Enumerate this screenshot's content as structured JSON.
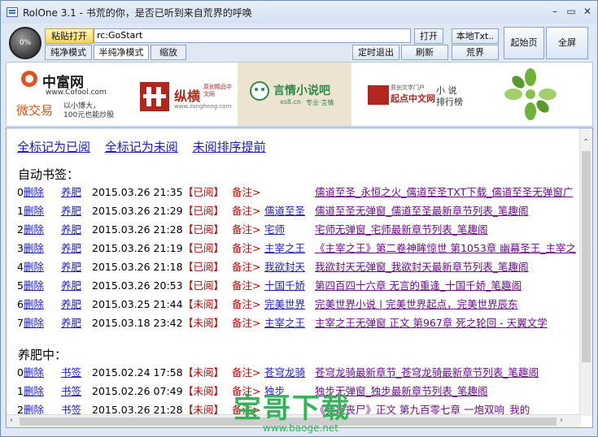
{
  "window": {
    "title": "RolOne 3.1 - 书荒的你，是否已听到来自荒界的呼唤",
    "min": "–",
    "max": "▭",
    "close": "✕"
  },
  "toolbar": {
    "orb_label": "0%",
    "paste_open": "粘贴打开",
    "address_value": "rc:GoStart",
    "open": "打开",
    "local_txt": "本地Txt..",
    "home": "起始页",
    "fullscreen": "全屏",
    "pure_mode": "纯净模式",
    "half_pure_mode": "半纯净模式",
    "zoom": "缩放",
    "timed_exit": "定时退出",
    "refresh": "刷新",
    "wasteland": "荒界"
  },
  "banner": {
    "cofool": {
      "brand": "中富网",
      "url": "www.Cofool.com",
      "slogan1": "微交易",
      "slogan2": "以小博大，",
      "slogan3": "100元也能炒股"
    },
    "zongheng": {
      "brand": "纵横",
      "sub": "原创精品中文网",
      "url": "www.zongheng.com"
    },
    "xs8": {
      "brand": "言情小说吧",
      "url": "xs8.cn",
      "sub": "专业·言情"
    },
    "qidian": {
      "brand": "起点中文网",
      "tag": "原创文学门户",
      "side1": "小 说",
      "side2": "排行榜"
    }
  },
  "links": {
    "mark_all_read": "全标记为已阅",
    "mark_all_unread": "全标记为未阅",
    "unread_first": "未阅排序提前"
  },
  "auto_section": {
    "title": "自动书签：",
    "rows": [
      {
        "idx": "0",
        "del": "删除",
        "op": "养肥",
        "time": "2015.03.26 21:35",
        "status": "【已阅】",
        "note": "备注>",
        "name": "",
        "desc": "儒道至圣_永恒之火_儒道至圣TXT下载_儒道至圣无弹窗广"
      },
      {
        "idx": "1",
        "del": "删除",
        "op": "养肥",
        "time": "2015.03.26 21:29",
        "status": "【已阅】",
        "note": "备注>",
        "name": "儒道至圣",
        "desc": "儒道至圣无弹窗_儒道至圣最新章节列表_笔趣阁"
      },
      {
        "idx": "2",
        "del": "删除",
        "op": "养肥",
        "time": "2015.03.26 21:28",
        "status": "【已阅】",
        "note": "备注>",
        "name": "宅师",
        "desc": "宅师无弹窗_宅师最新章节列表_笔趣阁"
      },
      {
        "idx": "3",
        "del": "删除",
        "op": "养肥",
        "time": "2015.03.26 21:19",
        "status": "【已阅】",
        "note": "备注>",
        "name": "主宰之王",
        "desc": "《主宰之王》第二卷神眸惊世 第1053章 幽幕圣王_主宰之"
      },
      {
        "idx": "4",
        "del": "删除",
        "op": "养肥",
        "time": "2015.03.26 21:18",
        "status": "【已阅】",
        "note": "备注>",
        "name": "我欲封天",
        "desc": "我欲封天无弹窗_我欲封天最新章节列表_笔趣阁"
      },
      {
        "idx": "5",
        "del": "删除",
        "op": "养肥",
        "time": "2015.03.26 20:53",
        "status": "【已阅】",
        "note": "备注>",
        "name": "十国千娇",
        "desc": "第四百四十六章 无言的重逢_十国千娇_笔趣阁"
      },
      {
        "idx": "6",
        "del": "删除",
        "op": "养肥",
        "time": "2015.03.25 21:44",
        "status": "【未阅】",
        "note": "备注>",
        "name": "完美世界",
        "desc": "完美世界小说 | 完美世界起点，完美世界辰东"
      },
      {
        "idx": "7",
        "del": "删除",
        "op": "养肥",
        "time": "2015.03.18 23:42",
        "status": "【未阅】",
        "note": "备注>",
        "name": "主宰之王",
        "desc": "主宰之王无弹窗 正文 第967章 死之轮回 - 天翼文学"
      }
    ]
  },
  "fatten_section": {
    "title": "养肥中：",
    "rows": [
      {
        "idx": "0",
        "del": "删除",
        "op": "书签",
        "time": "2015.02.24 17:58",
        "status": "【未阅】",
        "note": "备注>",
        "name": "苍穹龙骑",
        "desc": "苍穹龙骑最新章节_苍穹龙骑最新章节列表_笔趣阁"
      },
      {
        "idx": "1",
        "del": "删除",
        "op": "书签",
        "time": "2015.02.26 07:49",
        "status": "【未阅】",
        "note": "备注>",
        "name": "独步",
        "desc": "独步无弹窗_独步最新章节列表_笔趣阁"
      },
      {
        "idx": "2",
        "del": "删除",
        "op": "书签",
        "time": "2015.03.26 21:28",
        "status": "【未阅】",
        "note": "备注>",
        "name": "",
        "desc": "《我是丧尸》正文 第九百零七章 一炮双响_我的"
      }
    ]
  },
  "watermark": {
    "brand": "宝哥下载",
    "url": "www.baoge.net"
  },
  "colors": {
    "link": "#1b1bc7",
    "visited": "#6a0d8a",
    "status": "#c00000",
    "watermark": "#36b35a"
  }
}
